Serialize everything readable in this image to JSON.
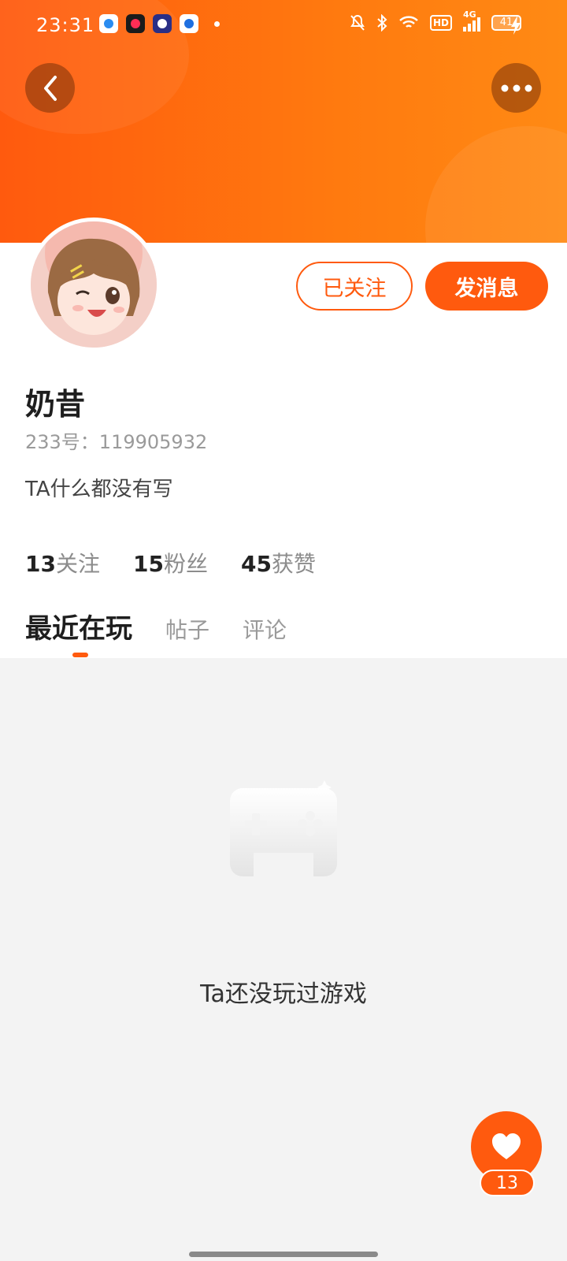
{
  "status_bar": {
    "time": "23:31",
    "battery": "41",
    "network": "4G",
    "hd": "HD"
  },
  "header": {
    "back_icon": "chevron-left-icon",
    "more_icon": "more-dots-icon"
  },
  "profile": {
    "follow_label": "已关注",
    "message_label": "发消息",
    "nickname": "奶昔",
    "uid": "233号：119905932",
    "bio": "TA什么都没有写",
    "stats": [
      {
        "num": "13",
        "label": "关注"
      },
      {
        "num": "15",
        "label": "粉丝"
      },
      {
        "num": "45",
        "label": "获赞"
      }
    ]
  },
  "tabs": [
    {
      "label": "最近在玩",
      "active": true
    },
    {
      "label": "帖子",
      "active": false
    },
    {
      "label": "评论",
      "active": false
    }
  ],
  "empty_state": {
    "icon": "gamepad-icon",
    "text": "Ta还没玩过游戏"
  },
  "like_fab": {
    "icon": "heart-icon",
    "count": "13"
  },
  "colors": {
    "accent": "#ff5a0e"
  }
}
